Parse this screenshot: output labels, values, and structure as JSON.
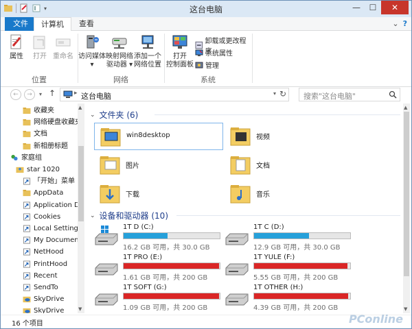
{
  "window": {
    "title": "这台电脑",
    "minimize": "—",
    "maximize": "☐",
    "close": "✕"
  },
  "ribbon": {
    "tabs": {
      "file": "文件",
      "computer": "计算机",
      "view": "查看"
    },
    "groups": {
      "location": {
        "label": "位置",
        "properties": "属性",
        "open": "打开",
        "rename": "重命名"
      },
      "network": {
        "label": "网络",
        "access_media": "访问媒体",
        "map_drive_l1": "映射网络",
        "map_drive_l2": "驱动器",
        "add_location_l1": "添加一个",
        "add_location_l2": "网络位置"
      },
      "system": {
        "label": "系统",
        "control_panel_l1": "打开",
        "control_panel_l2": "控制面板",
        "uninstall": "卸载或更改程序",
        "sys_props": "系统属性",
        "manage": "管理"
      }
    }
  },
  "address": {
    "breadcrumb": "这台电脑",
    "search_placeholder": "搜索\"这台电脑\""
  },
  "nav": {
    "items": [
      {
        "label": "收藏夹",
        "icon": "folder-icon"
      },
      {
        "label": "网络硬盘收藏夹",
        "icon": "folder-icon"
      },
      {
        "label": "文档",
        "icon": "folder-icon"
      },
      {
        "label": "新相册标题",
        "icon": "folder-icon"
      },
      {
        "label": "家庭组",
        "icon": "homegroup-icon"
      },
      {
        "label": "star 1020",
        "icon": "user-folder-icon"
      },
      {
        "label": "「开始」菜单",
        "icon": "shortcut-icon"
      },
      {
        "label": "AppData",
        "icon": "folder-icon"
      },
      {
        "label": "Application Data",
        "icon": "shortcut-icon"
      },
      {
        "label": "Cookies",
        "icon": "shortcut-icon"
      },
      {
        "label": "Local Settings",
        "icon": "shortcut-icon"
      },
      {
        "label": "My Documents",
        "icon": "shortcut-icon"
      },
      {
        "label": "NetHood",
        "icon": "shortcut-icon"
      },
      {
        "label": "PrintHood",
        "icon": "shortcut-icon"
      },
      {
        "label": "Recent",
        "icon": "shortcut-icon"
      },
      {
        "label": "SendTo",
        "icon": "shortcut-icon"
      },
      {
        "label": "SkyDrive",
        "icon": "skydrive-icon"
      },
      {
        "label": "SkyDrive",
        "icon": "skydrive-icon"
      }
    ]
  },
  "folders": {
    "title": "文件夹 (6)",
    "items": [
      {
        "name": "win8desktop",
        "icon": "desktop-folder-icon"
      },
      {
        "name": "视频",
        "icon": "videos-folder-icon"
      },
      {
        "name": "图片",
        "icon": "pictures-folder-icon"
      },
      {
        "name": "文档",
        "icon": "documents-folder-icon"
      },
      {
        "name": "下载",
        "icon": "downloads-folder-icon"
      },
      {
        "name": "音乐",
        "icon": "music-folder-icon"
      }
    ]
  },
  "drives": {
    "title": "设备和驱动器 (10)",
    "items": [
      {
        "name": "1T D (C:)",
        "free": "16.2 GB 可用，共 30.0 GB",
        "used_pct": 46,
        "color": "#26a0da",
        "icon": "windows-drive-icon"
      },
      {
        "name": "1T C (D:)",
        "free": "12.9 GB 可用，共 30.0 GB",
        "used_pct": 57,
        "color": "#26a0da",
        "icon": "hard-drive-icon"
      },
      {
        "name": "1T PRO (E:)",
        "free": "1.61 GB 可用，共 200 GB",
        "used_pct": 99,
        "color": "#da2626",
        "icon": "hard-drive-icon"
      },
      {
        "name": "1T YULE (F:)",
        "free": "5.55 GB 可用，共 200 GB",
        "used_pct": 97,
        "color": "#da2626",
        "icon": "hard-drive-icon"
      },
      {
        "name": "1T SOFT (G:)",
        "free": "1.09 GB 可用，共 200 GB",
        "used_pct": 99,
        "color": "#da2626",
        "icon": "hard-drive-icon"
      },
      {
        "name": "1T OTHER (H:)",
        "free": "4.39 GB 可用，共 200 GB",
        "used_pct": 98,
        "color": "#da2626",
        "icon": "hard-drive-icon"
      }
    ]
  },
  "status": {
    "count": "16 个项目",
    "watermark": "PConline"
  }
}
